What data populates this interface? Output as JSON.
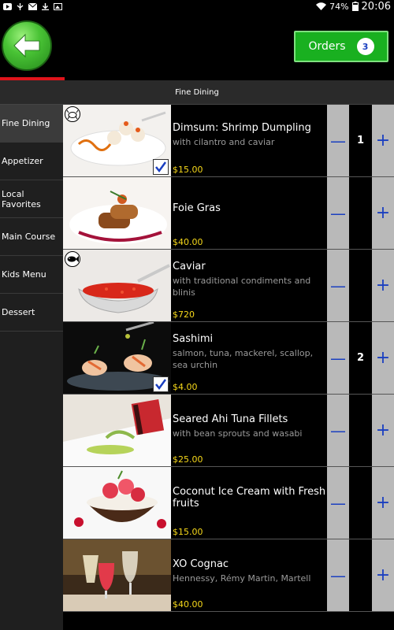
{
  "status_bar": {
    "battery": "74%",
    "time": "20:06",
    "icons": [
      "youtube-icon",
      "usb-icon",
      "mail-icon",
      "download-icon",
      "image-icon",
      "wifi-icon",
      "battery-icon"
    ]
  },
  "header": {
    "back_icon": "back-arrow-icon",
    "orders_label": "Orders",
    "orders_count": "3"
  },
  "category_title": "Fine Dining",
  "sidebar": {
    "items": [
      {
        "label": "Fine Dining",
        "active": true
      },
      {
        "label": "Appetizer"
      },
      {
        "label": "Local Favorites"
      },
      {
        "label": "Main Course"
      },
      {
        "label": "Kids Menu"
      },
      {
        "label": "Dessert"
      }
    ]
  },
  "menu_items": [
    {
      "name": "Dimsum: Shrimp Dumpling",
      "desc": "with cilantro and caviar",
      "price": "$15.00",
      "qty": "1",
      "badge": "crab-icon",
      "checked": true
    },
    {
      "name": "Foie Gras",
      "desc": "",
      "price": "$40.00",
      "qty": "",
      "badge": "",
      "checked": false
    },
    {
      "name": "Caviar",
      "desc": "with traditional condiments and blinis",
      "price": "$720",
      "qty": "",
      "badge": "fish-icon",
      "checked": false
    },
    {
      "name": "Sashimi",
      "desc": "salmon, tuna, mackerel, scallop, sea urchin",
      "price": "$4.00",
      "qty": "2",
      "badge": "",
      "checked": true
    },
    {
      "name": "Seared Ahi Tuna Fillets",
      "desc": "with bean sprouts and wasabi",
      "price": "$25.00",
      "qty": "",
      "badge": "",
      "checked": false
    },
    {
      "name": "Coconut Ice Cream with Fresh fruits",
      "desc": "",
      "price": "$15.00",
      "qty": "",
      "badge": "",
      "checked": false
    },
    {
      "name": "XO Cognac",
      "desc": "Hennessy, Rémy Martin, Martell",
      "price": "$40.00",
      "qty": "",
      "badge": "",
      "checked": false
    }
  ],
  "controls": {
    "minus": "—",
    "plus": "+"
  },
  "colors": {
    "accent_green": "#19b020",
    "price_yellow": "#f6d81a",
    "stepper_blue": "#1a3fc0",
    "underline_red": "#e0141b"
  }
}
